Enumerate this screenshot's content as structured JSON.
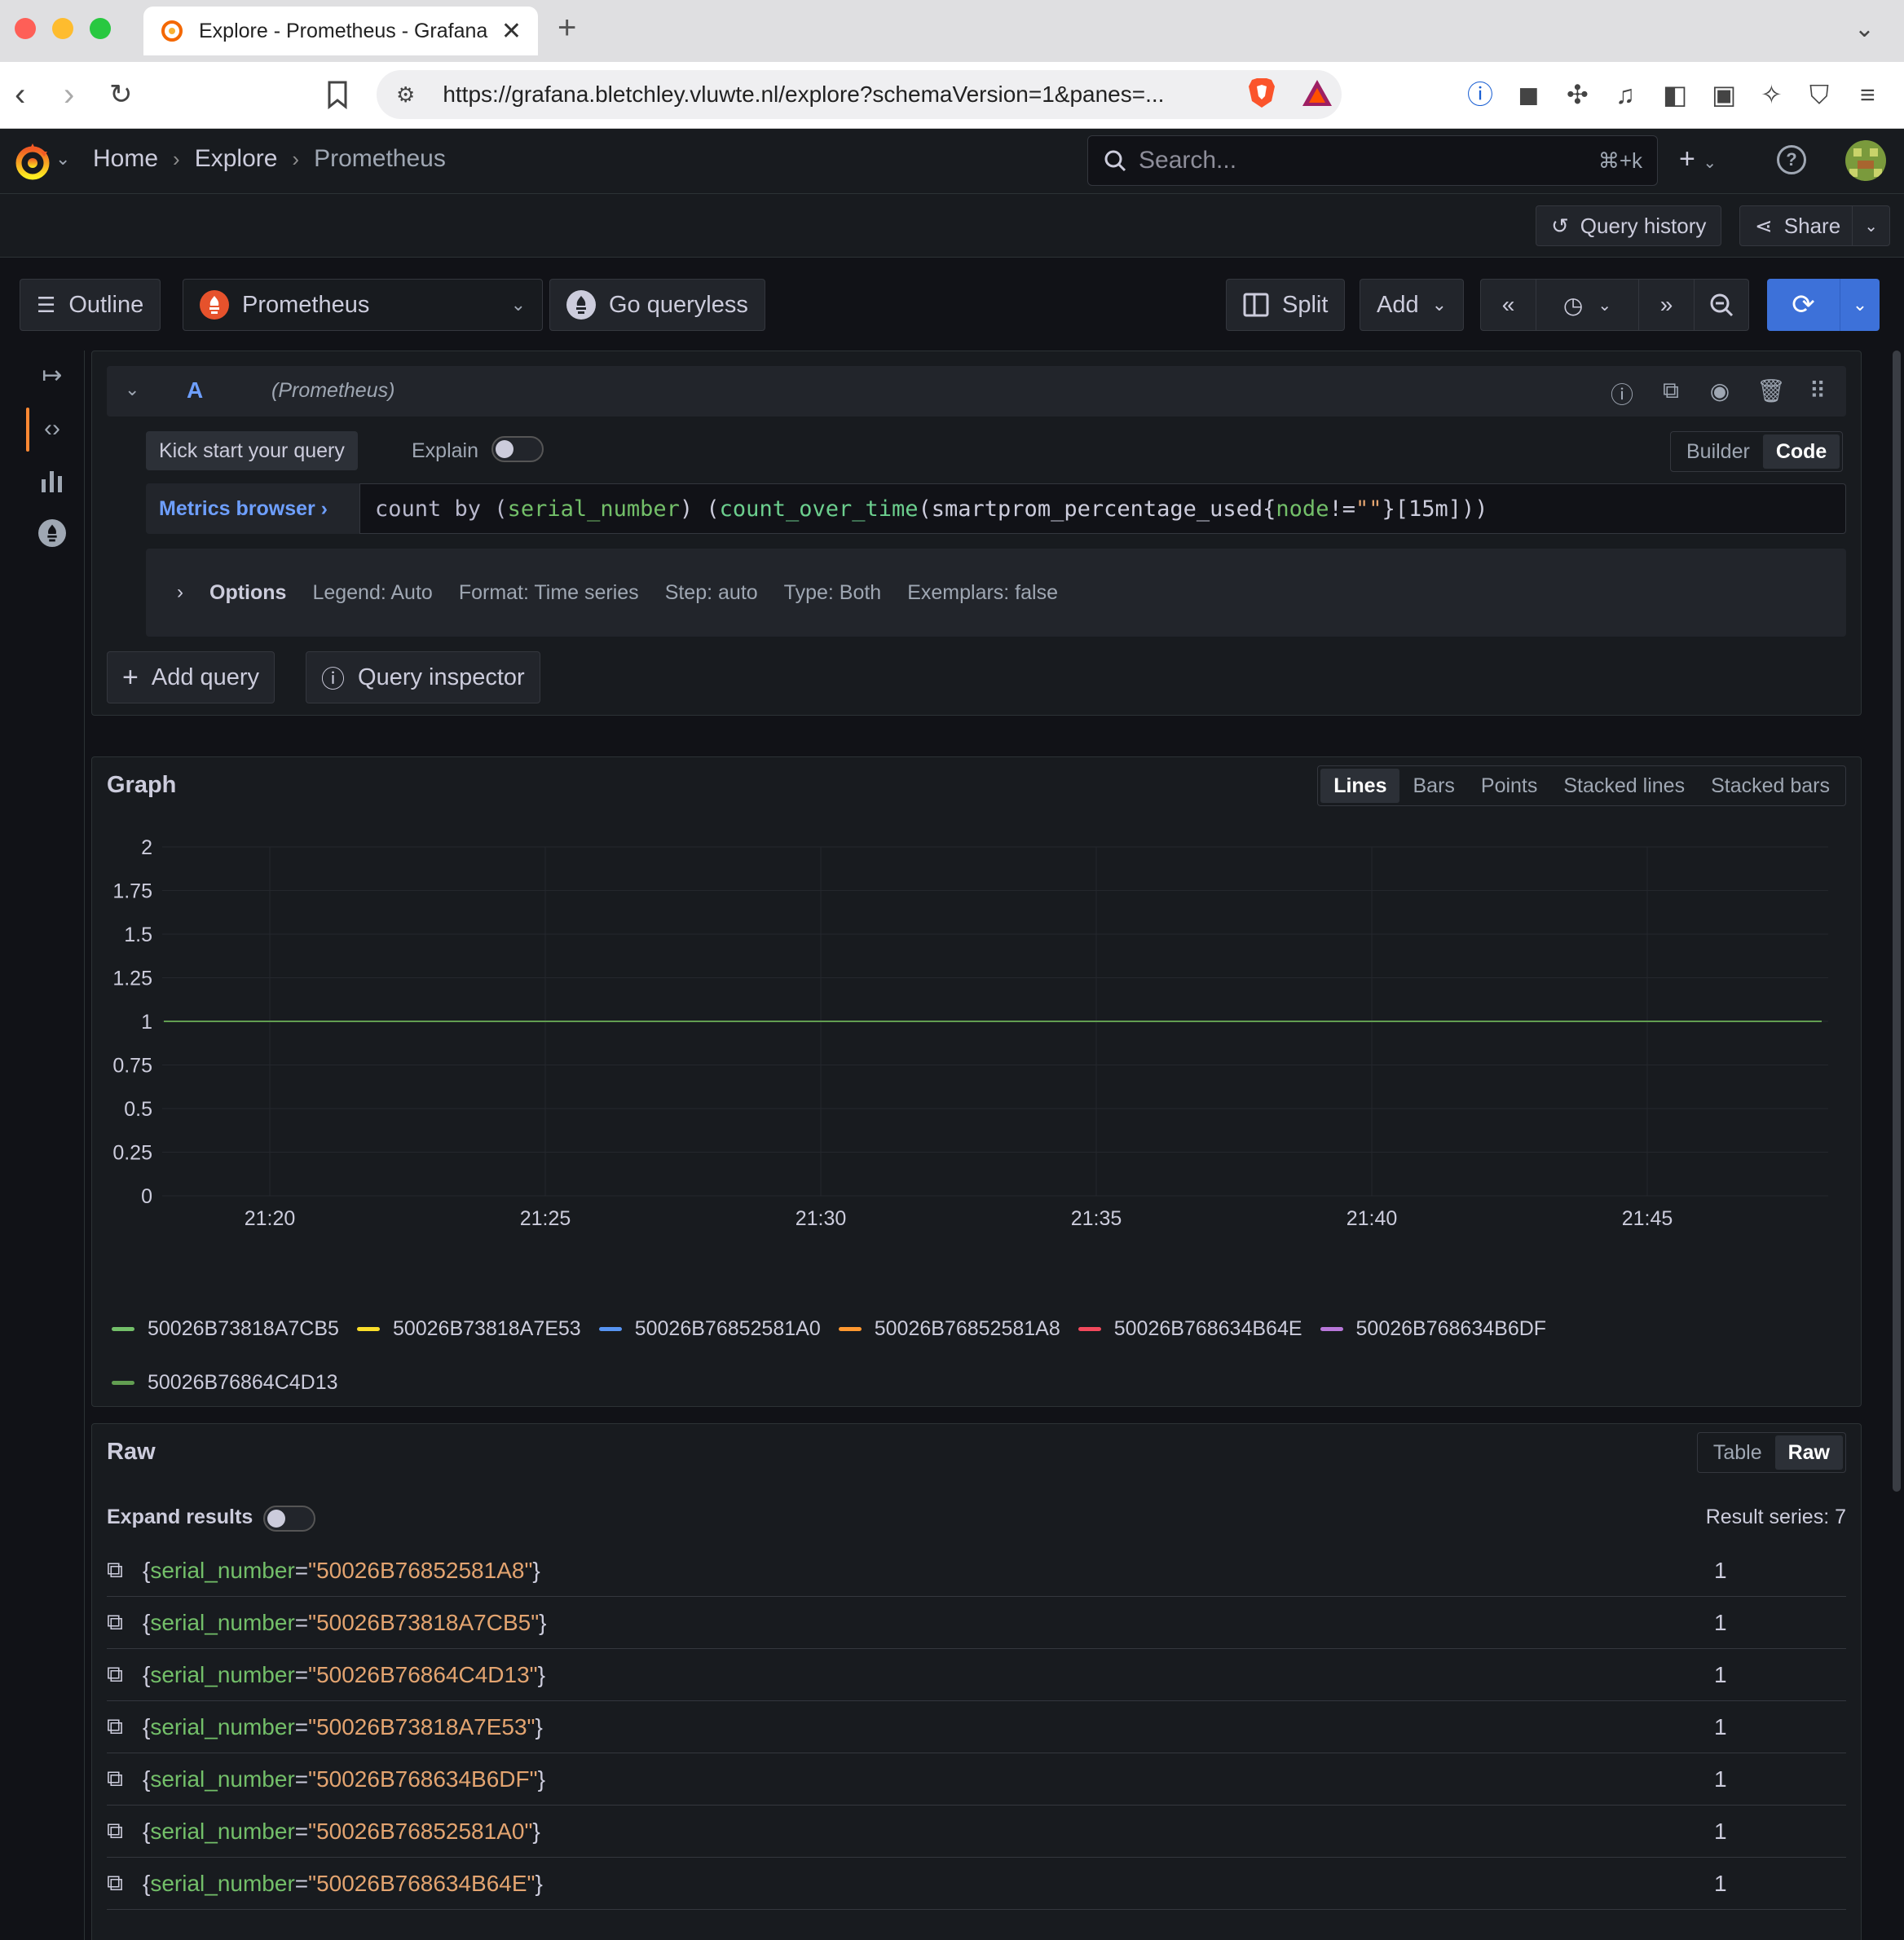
{
  "browser": {
    "tab_title": "Explore - Prometheus - Grafana",
    "url": "https://grafana.bletchley.vluwte.nl/explore?schemaVersion=1&panes=..."
  },
  "breadcrumbs": [
    "Home",
    "Explore",
    "Prometheus"
  ],
  "search": {
    "placeholder": "Search...",
    "shortcut": "⌘+k"
  },
  "actions": {
    "query_history": "Query history",
    "share": "Share"
  },
  "toolbar": {
    "outline": "Outline",
    "datasource": "Prometheus",
    "go_queryless": "Go queryless",
    "split": "Split",
    "add": "Add"
  },
  "query": {
    "letter": "A",
    "datasource": "(Prometheus)",
    "kick_start": "Kick start your query",
    "explain": "Explain",
    "mode_builder": "Builder",
    "mode_code": "Code",
    "metrics_browser": "Metrics browser ›",
    "expr": {
      "p1": "count by (",
      "p2": "serial_number",
      "p3": ") (",
      "p4": "count_over_time",
      "p5": "(smartprom_percentage_used{",
      "p6": "node",
      "p7": "!=",
      "p8": "\"\"",
      "p9": "}[15m]))"
    },
    "options": {
      "title": "Options",
      "legend": "Legend: Auto",
      "format": "Format: Time series",
      "step": "Step: auto",
      "type": "Type: Both",
      "exemplars": "Exemplars: false"
    },
    "add_query": "Add query",
    "query_inspector": "Query inspector"
  },
  "graph": {
    "title": "Graph",
    "types": [
      "Lines",
      "Bars",
      "Points",
      "Stacked lines",
      "Stacked bars"
    ],
    "active_type": "Lines"
  },
  "chart_data": {
    "type": "line",
    "x": [
      "21:20",
      "21:25",
      "21:30",
      "21:35",
      "21:40",
      "21:45"
    ],
    "ylim": [
      0,
      2
    ],
    "yticks": [
      "0",
      "0.25",
      "0.5",
      "0.75",
      "1",
      "1.25",
      "1.5",
      "1.75",
      "2"
    ],
    "grid": true,
    "legend_placement": "bottom",
    "series": [
      {
        "name": "50026B73818A7CB5",
        "color": "#73bf69",
        "values": [
          1,
          1,
          1,
          1,
          1,
          1
        ]
      },
      {
        "name": "50026B73818A7E53",
        "color": "#fade2a",
        "values": [
          1,
          1,
          1,
          1,
          1,
          1
        ]
      },
      {
        "name": "50026B76852581A0",
        "color": "#5794f2",
        "values": [
          1,
          1,
          1,
          1,
          1,
          1
        ]
      },
      {
        "name": "50026B76852581A8",
        "color": "#ff9830",
        "values": [
          1,
          1,
          1,
          1,
          1,
          1
        ]
      },
      {
        "name": "50026B768634B64E",
        "color": "#f2495c",
        "values": [
          1,
          1,
          1,
          1,
          1,
          1
        ]
      },
      {
        "name": "50026B768634B6DF",
        "color": "#b877d9",
        "values": [
          1,
          1,
          1,
          1,
          1,
          1
        ]
      },
      {
        "name": "50026B76864C4D13",
        "color": "#629e51",
        "values": [
          1,
          1,
          1,
          1,
          1,
          1
        ]
      }
    ]
  },
  "raw": {
    "title": "Raw",
    "view_table": "Table",
    "view_raw": "Raw",
    "expand_results": "Expand results",
    "result_series": "Result series: 7",
    "rows": [
      {
        "label": "serial_number",
        "value": "50026B76852581A8",
        "result": "1"
      },
      {
        "label": "serial_number",
        "value": "50026B73818A7CB5",
        "result": "1"
      },
      {
        "label": "serial_number",
        "value": "50026B76864C4D13",
        "result": "1"
      },
      {
        "label": "serial_number",
        "value": "50026B73818A7E53",
        "result": "1"
      },
      {
        "label": "serial_number",
        "value": "50026B768634B6DF",
        "result": "1"
      },
      {
        "label": "serial_number",
        "value": "50026B76852581A0",
        "result": "1"
      },
      {
        "label": "serial_number",
        "value": "50026B768634B64E",
        "result": "1"
      }
    ]
  }
}
